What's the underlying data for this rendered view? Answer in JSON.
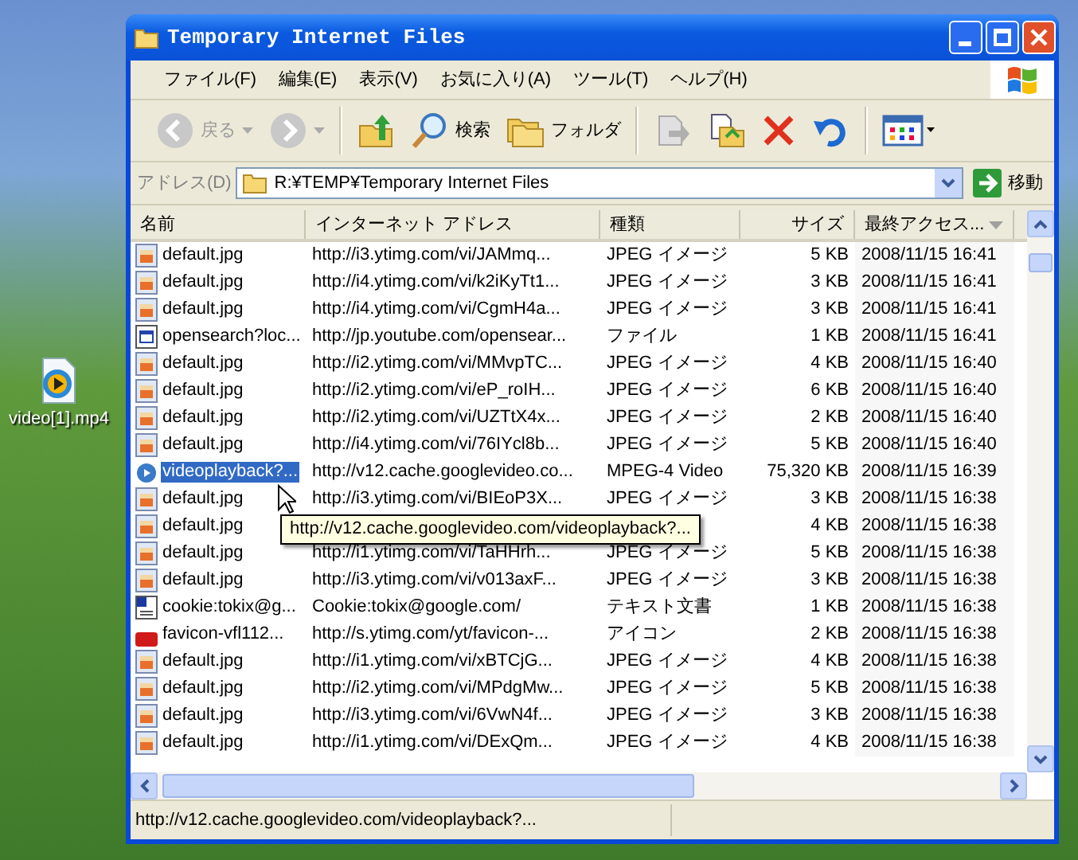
{
  "desktop_icon": {
    "label": "video[1].mp4"
  },
  "window": {
    "title": "Temporary Internet Files"
  },
  "menu": [
    {
      "label": "ファイル(F)"
    },
    {
      "label": "編集(E)"
    },
    {
      "label": "表示(V)"
    },
    {
      "label": "お気に入り(A)"
    },
    {
      "label": "ツール(T)"
    },
    {
      "label": "ヘルプ(H)"
    }
  ],
  "toolbar": [
    {
      "kind": "back",
      "label": "戻る",
      "disabled": true
    },
    {
      "kind": "forward",
      "disabled": true
    },
    {
      "kind": "up",
      "disabled": false
    },
    {
      "kind": "search",
      "label": "検索",
      "disabled": false
    },
    {
      "kind": "folders",
      "label": "フォルダ",
      "disabled": false
    },
    {
      "kind": "move",
      "disabled": true
    },
    {
      "kind": "copy",
      "disabled": false
    },
    {
      "kind": "delete",
      "disabled": false
    },
    {
      "kind": "undo",
      "disabled": false
    },
    {
      "kind": "views",
      "disabled": false
    }
  ],
  "address_bar": {
    "label": "アドレス(D)",
    "value": "R:¥TEMP¥Temporary Internet Files",
    "go_label": "移動"
  },
  "table": {
    "columns": [
      {
        "label": "名前",
        "sorted": false
      },
      {
        "label": "インターネット アドレス",
        "sorted": false
      },
      {
        "label": "種類",
        "sorted": false
      },
      {
        "label": "サイズ",
        "sorted": false
      },
      {
        "label": "最終アクセス...",
        "sorted": true
      }
    ],
    "rows": [
      {
        "kind": "jpeg",
        "name": "default.jpg",
        "address": "http://i3.ytimg.com/vi/JAMmq...",
        "type": "JPEG イメージ",
        "size": "5 KB",
        "accessed": "2008/11/15 16:41",
        "selected": false
      },
      {
        "kind": "jpeg",
        "name": "default.jpg",
        "address": "http://i4.ytimg.com/vi/k2iKyTt1...",
        "type": "JPEG イメージ",
        "size": "3 KB",
        "accessed": "2008/11/15 16:41",
        "selected": false
      },
      {
        "kind": "jpeg",
        "name": "default.jpg",
        "address": "http://i4.ytimg.com/vi/CgmH4a...",
        "type": "JPEG イメージ",
        "size": "3 KB",
        "accessed": "2008/11/15 16:41",
        "selected": false
      },
      {
        "kind": "file",
        "name": "opensearch?loc...",
        "address": "http://jp.youtube.com/opensear...",
        "type": "ファイル",
        "size": "1 KB",
        "accessed": "2008/11/15 16:41",
        "selected": false
      },
      {
        "kind": "jpeg",
        "name": "default.jpg",
        "address": "http://i2.ytimg.com/vi/MMvpTC...",
        "type": "JPEG イメージ",
        "size": "4 KB",
        "accessed": "2008/11/15 16:40",
        "selected": false
      },
      {
        "kind": "jpeg",
        "name": "default.jpg",
        "address": "http://i2.ytimg.com/vi/eP_roIH...",
        "type": "JPEG イメージ",
        "size": "6 KB",
        "accessed": "2008/11/15 16:40",
        "selected": false
      },
      {
        "kind": "jpeg",
        "name": "default.jpg",
        "address": "http://i2.ytimg.com/vi/UZTtX4x...",
        "type": "JPEG イメージ",
        "size": "2 KB",
        "accessed": "2008/11/15 16:40",
        "selected": false
      },
      {
        "kind": "jpeg",
        "name": "default.jpg",
        "address": "http://i4.ytimg.com/vi/76IYcl8b...",
        "type": "JPEG イメージ",
        "size": "5 KB",
        "accessed": "2008/11/15 16:40",
        "selected": false
      },
      {
        "kind": "video",
        "name": "videoplayback?...",
        "address": "http://v12.cache.googlevideo.co...",
        "type": "MPEG-4 Video",
        "size": "75,320 KB",
        "accessed": "2008/11/15 16:39",
        "selected": true
      },
      {
        "kind": "jpeg",
        "name": "default.jpg",
        "address": "http://i3.ytimg.com/vi/BIEoP3X...",
        "type": "JPEG イメージ",
        "size": "3 KB",
        "accessed": "2008/11/15 16:38",
        "selected": false
      },
      {
        "kind": "jpeg",
        "name": "default.jpg",
        "size": "4 KB",
        "accessed": "2008/11/15 16:38",
        "selected": false
      },
      {
        "kind": "jpeg",
        "name": "default.jpg",
        "address": "http://i1.ytimg.com/vi/TaHHrh...",
        "type": "JPEG イメージ",
        "size": "5 KB",
        "accessed": "2008/11/15 16:38",
        "selected": false
      },
      {
        "kind": "jpeg",
        "name": "default.jpg",
        "address": "http://i3.ytimg.com/vi/v013axF...",
        "type": "JPEG イメージ",
        "size": "3 KB",
        "accessed": "2008/11/15 16:38",
        "selected": false
      },
      {
        "kind": "text",
        "name": "cookie:tokix@g...",
        "address": "Cookie:tokix@google.com/",
        "type": "テキスト文書",
        "size": "1 KB",
        "accessed": "2008/11/15 16:38",
        "selected": false
      },
      {
        "kind": "icon",
        "name": "favicon-vfl112...",
        "address": "http://s.ytimg.com/yt/favicon-...",
        "type": "アイコン",
        "size": "2 KB",
        "accessed": "2008/11/15 16:38",
        "selected": false
      },
      {
        "kind": "jpeg",
        "name": "default.jpg",
        "address": "http://i1.ytimg.com/vi/xBTCjG...",
        "type": "JPEG イメージ",
        "size": "4 KB",
        "accessed": "2008/11/15 16:38",
        "selected": false
      },
      {
        "kind": "jpeg",
        "name": "default.jpg",
        "address": "http://i2.ytimg.com/vi/MPdgMw...",
        "type": "JPEG イメージ",
        "size": "5 KB",
        "accessed": "2008/11/15 16:38",
        "selected": false
      },
      {
        "kind": "jpeg",
        "name": "default.jpg",
        "address": "http://i3.ytimg.com/vi/6VwN4f...",
        "type": "JPEG イメージ",
        "size": "3 KB",
        "accessed": "2008/11/15 16:38",
        "selected": false
      },
      {
        "kind": "jpeg",
        "name": "default.jpg",
        "address": "http://i1.ytimg.com/vi/DExQm...",
        "type": "JPEG イメージ",
        "size": "4 KB",
        "accessed": "2008/11/15 16:38",
        "selected": false
      }
    ]
  },
  "tooltip": {
    "text": "http://v12.cache.googlevideo.com/videoplayback?..."
  },
  "status_bar": {
    "text": "http://v12.cache.googlevideo.com/videoplayback?..."
  }
}
